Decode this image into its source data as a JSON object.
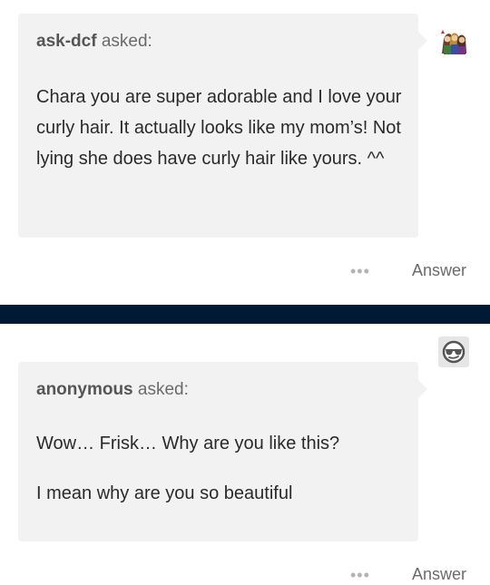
{
  "posts": [
    {
      "asker": "ask-dcf",
      "asked_label": "asked:",
      "paragraphs": [
        "Chara you are super adorable and I love your curly hair. It actually looks like my mom’s! Not lying she does have curly hair like yours. ^^"
      ],
      "avatar_icon": "group-avatar-icon",
      "more_label": "•••",
      "answer_label": "Answer"
    },
    {
      "asker": "anonymous",
      "asked_label": "asked:",
      "paragraphs": [
        "Wow… Frisk… Why are you like this?",
        "I mean why are you so beautiful"
      ],
      "avatar_icon": "anonymous-sunglasses-icon",
      "more_label": "•••",
      "answer_label": "Answer"
    }
  ],
  "colors": {
    "divider": "#001935",
    "bubble": "#f2f2f2",
    "text": "#2a2a2a",
    "muted": "#6b6b6b"
  }
}
